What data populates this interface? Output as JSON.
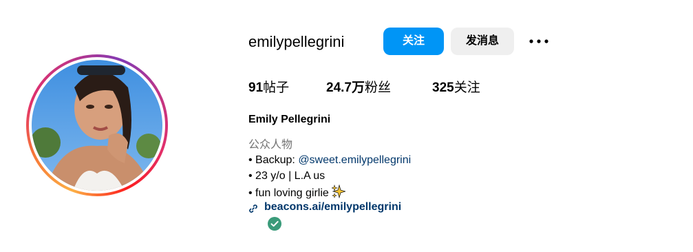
{
  "profile": {
    "username": "emilypellegrini",
    "follow_label": "关注",
    "message_label": "发消息",
    "more_icon": "more-options-icon",
    "stats": {
      "posts_count": "91",
      "posts_label": "帖子",
      "followers_count": "24.7万",
      "followers_label": "粉丝",
      "following_count": "325",
      "following_label": "关注"
    },
    "full_name": "Emily Pellegrini",
    "category": "公众人物",
    "bio": {
      "line1_prefix": "• Backup: ",
      "line1_mention": "@sweet.emilypellegrini",
      "line2": "• 23 y/o | L.A us",
      "line3": "• fun loving girlie",
      "line3_emoji": "sparkles-icon"
    },
    "link": "beacons.ai/emilypellegrini",
    "link_icon": "link-icon",
    "verified_icon": "verified-check-icon"
  },
  "colors": {
    "follow_button": "#0095f6",
    "message_button": "#efefef",
    "link": "#00376b",
    "category": "#737373",
    "verified": "#3a9b7a"
  }
}
